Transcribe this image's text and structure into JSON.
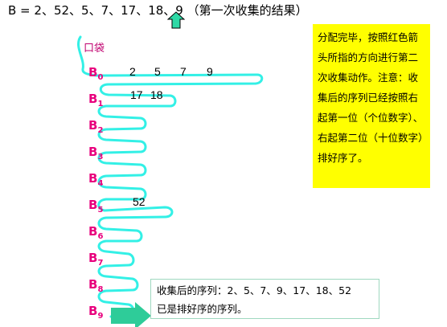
{
  "title": "B = 2、52、5、7、17、18、9 （第一次收集的结果）",
  "pocket_label": "口袋",
  "buckets": [
    {
      "letter": "B",
      "index": "0",
      "numbers": [
        "2",
        "5",
        "7",
        "9"
      ]
    },
    {
      "letter": "B",
      "index": "1",
      "numbers": [
        "17",
        "18"
      ]
    },
    {
      "letter": "B",
      "index": "2",
      "numbers": []
    },
    {
      "letter": "B",
      "index": "3",
      "numbers": []
    },
    {
      "letter": "B",
      "index": "4",
      "numbers": []
    },
    {
      "letter": "B",
      "index": "5",
      "numbers": [
        "52"
      ]
    },
    {
      "letter": "B",
      "index": "6",
      "numbers": []
    },
    {
      "letter": "B",
      "index": "7",
      "numbers": []
    },
    {
      "letter": "B",
      "index": "8",
      "numbers": []
    },
    {
      "letter": "B",
      "index": "9",
      "numbers": []
    }
  ],
  "note": "分配完毕，按照红色箭头所指的方向进行第二次收集动作。注意：收集后的序列已经按照右起第一位（个位数字）、右起第二位（十位数字）排好序了。",
  "result": {
    "line1": "收集后的序列：2、5、7、9、17、18、52",
    "line2": "已是排好序的序列。"
  },
  "colors": {
    "rope": "#33f0e6",
    "bucket_label": "#e8007d",
    "note_bg": "#ffff00",
    "arrow": "#2ecc99",
    "up_arrow": "#2ed9a6"
  }
}
